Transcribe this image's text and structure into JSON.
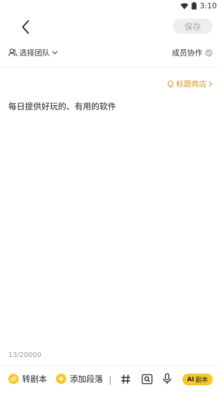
{
  "status_bar": {
    "time": "3:10"
  },
  "nav": {
    "save_label": "保存"
  },
  "team": {
    "select_label": "选择团队",
    "collab_label": "成员协作"
  },
  "editor": {
    "title_shop_label": "标题商店",
    "content": "每日提供好玩的、有用的软件",
    "word_count": "13/20000"
  },
  "toolbar": {
    "convert_label": "转剧本",
    "add_paragraph_label": "添加段落",
    "ai_label": "AI",
    "ai_sub_label": "剧本"
  },
  "colors": {
    "accent": "#f6c928",
    "shop": "#d29a2e",
    "save_bg": "#eeeeee"
  }
}
